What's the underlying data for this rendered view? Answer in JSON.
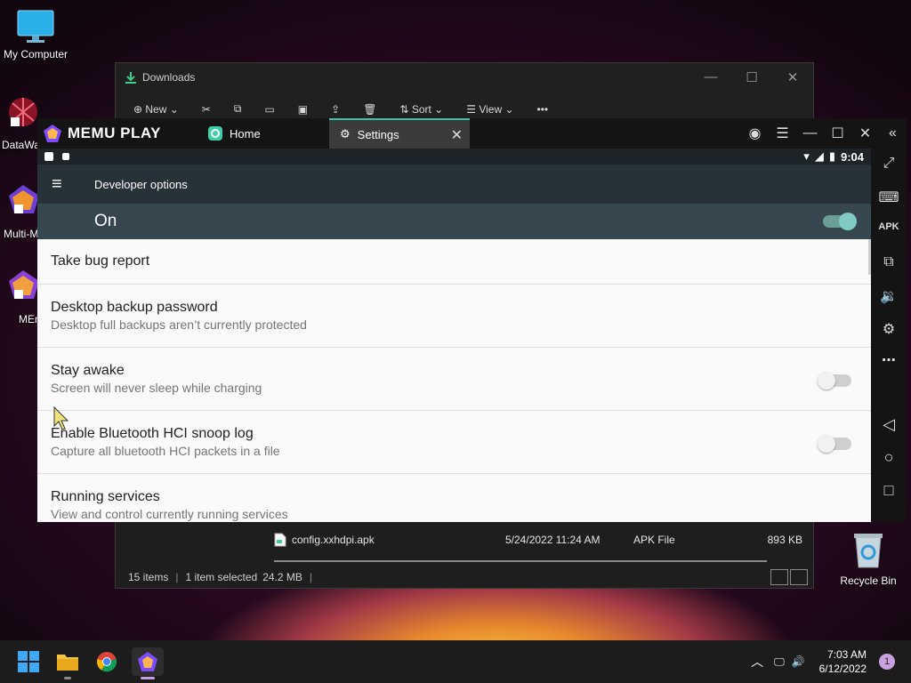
{
  "desktop": {
    "icons": [
      {
        "label": "My Computer"
      },
      {
        "label": "DataWa"
      },
      {
        "label": "Multi-M"
      },
      {
        "label": "MEr"
      }
    ],
    "recycle_bin": "Recycle Bin"
  },
  "explorer": {
    "title": "Downloads",
    "toolbar": {
      "new": "New",
      "sort": "Sort",
      "view": "View",
      "more": "•••"
    },
    "file": {
      "name": "config.xxhdpi.apk",
      "date": "5/24/2022 11:24 AM",
      "type": "APK File",
      "size": "893 KB"
    },
    "status": {
      "items": "15 items",
      "selected": "1 item selected",
      "size": "24.2 MB"
    }
  },
  "memu": {
    "logo": "MEMU PLAY",
    "tabs": [
      {
        "label": "Home"
      },
      {
        "label": "Settings"
      }
    ],
    "status_time": "9:04",
    "appbar_title": "Developer options",
    "master_switch": {
      "label": "On",
      "state": true
    },
    "prefs": [
      {
        "title": "Take bug report",
        "summary": ""
      },
      {
        "title": "Desktop backup password",
        "summary": "Desktop full backups aren’t currently protected"
      },
      {
        "title": "Stay awake",
        "summary": "Screen will never sleep while charging",
        "toggle": false
      },
      {
        "title": "Enable Bluetooth HCI snoop log",
        "summary": "Capture all bluetooth HCI packets in a file",
        "toggle": false
      },
      {
        "title": "Running services",
        "summary": "View and control currently running services"
      }
    ]
  },
  "taskbar": {
    "time": "7:03 AM",
    "date": "6/12/2022",
    "notifications": "1"
  },
  "colors": {
    "accent_teal": "#39c2a8",
    "appbar": "#263238",
    "onbar": "#37474f"
  }
}
